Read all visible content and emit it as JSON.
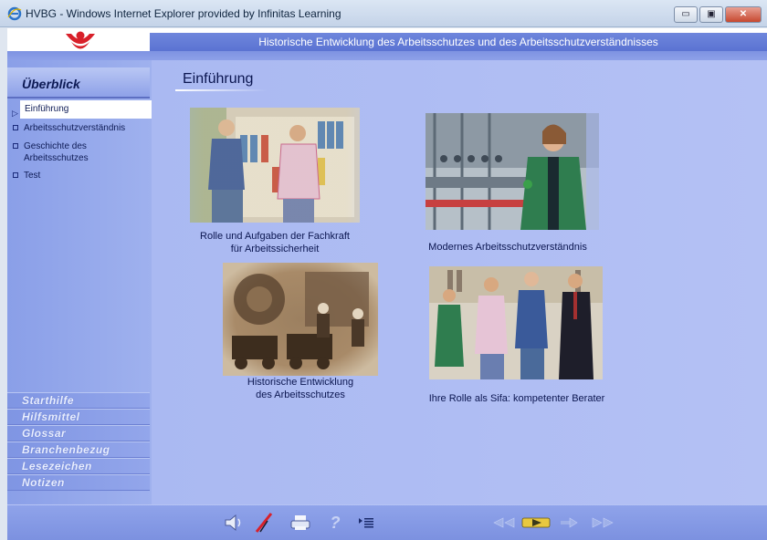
{
  "window": {
    "title": "HVBG - Windows Internet Explorer provided by Infinitas Learning",
    "minimize": "▭",
    "restore": "▣",
    "close": "✕"
  },
  "header": {
    "title": "Historische Entwicklung des Arbeitsschutzes und des Arbeitsschutzverständnisses"
  },
  "sidebar": {
    "heading": "Überblick",
    "items": [
      {
        "label": "Einführung",
        "active": true
      },
      {
        "label": "Arbeitsschutzverständnis"
      },
      {
        "label": "Geschichte des Arbeitsschutzes"
      },
      {
        "label": "Test"
      }
    ],
    "menu": [
      "Starthilfe",
      "Hilfsmittel",
      "Glossar",
      "Branchenbezug",
      "Lesezeichen",
      "Notizen"
    ]
  },
  "main": {
    "title": "Einführung",
    "tiles": [
      {
        "caption_line1": "Rolle und Aufgaben der Fachkraft",
        "caption_line2": "für Arbeitssicherheit"
      },
      {
        "caption_line1": "Modernes Arbeitsschutzverständnis",
        "caption_line2": ""
      },
      {
        "caption_line1": "Historische Entwicklung",
        "caption_line2": "des Arbeitsschutzes"
      },
      {
        "caption_line1": "Ihre Rolle als Sifa: kompetenter Berater",
        "caption_line2": ""
      }
    ]
  },
  "toolbar": {
    "icons": [
      "speaker-icon",
      "mute-icon",
      "print-icon",
      "help-icon",
      "menu-icon",
      "rewind-icon",
      "play-icon",
      "forward-icon",
      "fast-forward-icon"
    ]
  },
  "colors": {
    "accent": "#d8202a",
    "sidebar": "#8a9fe8",
    "main": "#aab9f2",
    "text": "#0b1650"
  }
}
